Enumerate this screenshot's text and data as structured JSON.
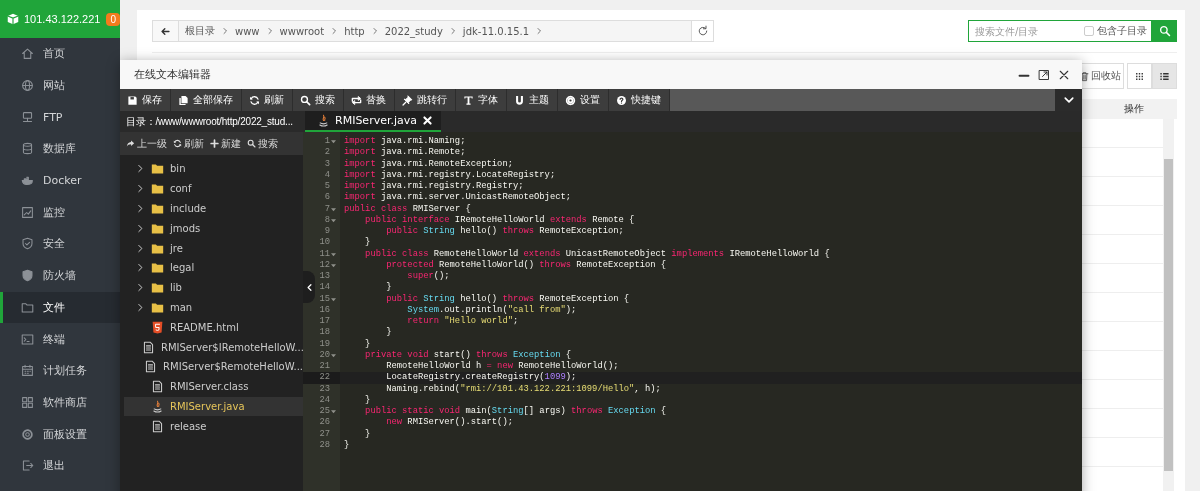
{
  "sidebar": {
    "host": "101.43.122.221",
    "badge": "0",
    "items": [
      {
        "label": "首页",
        "selected": false
      },
      {
        "label": "网站",
        "selected": false
      },
      {
        "label": "FTP",
        "selected": false
      },
      {
        "label": "数据库",
        "selected": false
      },
      {
        "label": "Docker",
        "selected": false
      },
      {
        "label": "监控",
        "selected": false
      },
      {
        "label": "安全",
        "selected": false
      },
      {
        "label": "防火墙",
        "selected": false
      },
      {
        "label": "文件",
        "selected": true
      },
      {
        "label": "终端",
        "selected": false
      },
      {
        "label": "计划任务",
        "selected": false
      },
      {
        "label": "软件商店",
        "selected": false
      },
      {
        "label": "面板设置",
        "selected": false
      },
      {
        "label": "退出",
        "selected": false
      }
    ]
  },
  "file_manager": {
    "breadcrumb": [
      "根目录",
      "www",
      "wwwroot",
      "http",
      "2022_study",
      "jdk-11.0.15.1"
    ],
    "search": {
      "placeholder": "搜索文件/目录",
      "subdir_label": "包含子目录",
      "subdir_checked": false
    },
    "recycle_label": "回收站",
    "view_modes": [
      {
        "selected": false
      },
      {
        "selected": true
      }
    ],
    "table": {
      "columns": [
        "操作"
      ]
    }
  },
  "editor": {
    "title": "在线文本编辑器",
    "toolbar": [
      "保存",
      "全部保存",
      "刷新",
      "搜索",
      "替换",
      "跳转行",
      "字体",
      "主题",
      "设置",
      "快捷键"
    ],
    "path": "目录：/www/wwwroot/http/2022_stud...",
    "file_actions": [
      "上一级",
      "刷新",
      "新建",
      "搜索"
    ],
    "files": [
      {
        "name": "bin",
        "kind": "folder",
        "selected": false
      },
      {
        "name": "conf",
        "kind": "folder",
        "selected": false
      },
      {
        "name": "include",
        "kind": "folder",
        "selected": false
      },
      {
        "name": "jmods",
        "kind": "folder",
        "selected": false
      },
      {
        "name": "jre",
        "kind": "folder",
        "selected": false
      },
      {
        "name": "legal",
        "kind": "folder",
        "selected": false
      },
      {
        "name": "lib",
        "kind": "folder",
        "selected": false
      },
      {
        "name": "man",
        "kind": "folder",
        "selected": false
      },
      {
        "name": "README.html",
        "kind": "html",
        "selected": false
      },
      {
        "name": "RMIServer$IRemoteHelloW...",
        "kind": "file",
        "selected": false
      },
      {
        "name": "RMIServer$RemoteHelloW...",
        "kind": "file",
        "selected": false
      },
      {
        "name": "RMIServer.class",
        "kind": "file",
        "selected": false
      },
      {
        "name": "RMIServer.java",
        "kind": "java",
        "selected": true
      },
      {
        "name": "release",
        "kind": "file",
        "selected": false
      }
    ],
    "tabs": [
      {
        "label": "RMIServer.java",
        "selected": true
      }
    ],
    "lines": [
      {
        "number": "1",
        "foldable": true,
        "active": false,
        "tokens": [
          {
            "kind": "keyword",
            "text": "import"
          },
          {
            "kind": "plain",
            "text": " java.rmi.Naming;"
          }
        ]
      },
      {
        "number": "2",
        "foldable": false,
        "active": false,
        "tokens": [
          {
            "kind": "keyword",
            "text": "import"
          },
          {
            "kind": "plain",
            "text": " java.rmi.Remote;"
          }
        ]
      },
      {
        "number": "3",
        "foldable": false,
        "active": false,
        "tokens": [
          {
            "kind": "keyword",
            "text": "import"
          },
          {
            "kind": "plain",
            "text": " java.rmi.RemoteException;"
          }
        ]
      },
      {
        "number": "4",
        "foldable": false,
        "active": false,
        "tokens": [
          {
            "kind": "keyword",
            "text": "import"
          },
          {
            "kind": "plain",
            "text": " java.rmi.registry.LocateRegistry;"
          }
        ]
      },
      {
        "number": "5",
        "foldable": false,
        "active": false,
        "tokens": [
          {
            "kind": "keyword",
            "text": "import"
          },
          {
            "kind": "plain",
            "text": " java.rmi.registry.Registry;"
          }
        ]
      },
      {
        "number": "6",
        "foldable": false,
        "active": false,
        "tokens": [
          {
            "kind": "keyword",
            "text": "import"
          },
          {
            "kind": "plain",
            "text": " java.rmi.server.UnicastRemoteObject;"
          }
        ]
      },
      {
        "number": "7",
        "foldable": true,
        "active": false,
        "tokens": [
          {
            "kind": "keyword",
            "text": "public"
          },
          {
            "kind": "keyword",
            "text": " class"
          },
          {
            "kind": "plain",
            "text": " RMIServer {"
          }
        ]
      },
      {
        "number": "8",
        "foldable": true,
        "active": false,
        "tokens": [
          {
            "kind": "keyword",
            "text": "    public"
          },
          {
            "kind": "keyword",
            "text": " interface"
          },
          {
            "kind": "plain",
            "text": " IRemoteHelloWorld "
          },
          {
            "kind": "keyword",
            "text": "extends"
          },
          {
            "kind": "plain",
            "text": " Remote {"
          }
        ]
      },
      {
        "number": "9",
        "foldable": false,
        "active": false,
        "tokens": [
          {
            "kind": "keyword",
            "text": "        public"
          },
          {
            "kind": "type",
            "text": " String"
          },
          {
            "kind": "plain",
            "text": " hello() "
          },
          {
            "kind": "keyword",
            "text": "throws"
          },
          {
            "kind": "plain",
            "text": " RemoteException;"
          }
        ]
      },
      {
        "number": "10",
        "foldable": false,
        "active": false,
        "tokens": [
          {
            "kind": "plain",
            "text": "    }"
          }
        ]
      },
      {
        "number": "11",
        "foldable": true,
        "active": false,
        "tokens": [
          {
            "kind": "keyword",
            "text": "    public"
          },
          {
            "kind": "keyword",
            "text": " class"
          },
          {
            "kind": "plain",
            "text": " RemoteHelloWorld "
          },
          {
            "kind": "keyword",
            "text": "extends"
          },
          {
            "kind": "plain",
            "text": " UnicastRemoteObject "
          },
          {
            "kind": "keyword",
            "text": "implements"
          },
          {
            "kind": "plain",
            "text": " IRemoteHelloWorld {"
          }
        ]
      },
      {
        "number": "12",
        "foldable": true,
        "active": false,
        "tokens": [
          {
            "kind": "keyword",
            "text": "        protected"
          },
          {
            "kind": "plain",
            "text": " RemoteHelloWorld() "
          },
          {
            "kind": "keyword",
            "text": "throws"
          },
          {
            "kind": "plain",
            "text": " RemoteException {"
          }
        ]
      },
      {
        "number": "13",
        "foldable": false,
        "active": false,
        "tokens": [
          {
            "kind": "keyword",
            "text": "            super"
          },
          {
            "kind": "plain",
            "text": "();"
          }
        ]
      },
      {
        "number": "14",
        "foldable": false,
        "active": false,
        "tokens": [
          {
            "kind": "plain",
            "text": "        }"
          }
        ]
      },
      {
        "number": "15",
        "foldable": true,
        "active": false,
        "tokens": [
          {
            "kind": "keyword",
            "text": "        public"
          },
          {
            "kind": "type",
            "text": " String"
          },
          {
            "kind": "plain",
            "text": " hello() "
          },
          {
            "kind": "keyword",
            "text": "throws"
          },
          {
            "kind": "plain",
            "text": " RemoteException {"
          }
        ]
      },
      {
        "number": "16",
        "foldable": false,
        "active": false,
        "tokens": [
          {
            "kind": "type",
            "text": "            System"
          },
          {
            "kind": "plain",
            "text": ".out.println("
          },
          {
            "kind": "string",
            "text": "\"call from\""
          },
          {
            "kind": "plain",
            "text": ");"
          }
        ]
      },
      {
        "number": "17",
        "foldable": false,
        "active": false,
        "tokens": [
          {
            "kind": "keyword",
            "text": "            return"
          },
          {
            "kind": "string",
            "text": " \"Hello world\""
          },
          {
            "kind": "plain",
            "text": ";"
          }
        ]
      },
      {
        "number": "18",
        "foldable": false,
        "active": false,
        "tokens": [
          {
            "kind": "plain",
            "text": "        }"
          }
        ]
      },
      {
        "number": "19",
        "foldable": false,
        "active": false,
        "tokens": [
          {
            "kind": "plain",
            "text": "    }"
          }
        ]
      },
      {
        "number": "20",
        "foldable": true,
        "active": false,
        "tokens": [
          {
            "kind": "keyword",
            "text": "    private"
          },
          {
            "kind": "keyword",
            "text": " void"
          },
          {
            "kind": "plain",
            "text": " start() "
          },
          {
            "kind": "keyword",
            "text": "throws"
          },
          {
            "kind": "type",
            "text": " Exception"
          },
          {
            "kind": "plain",
            "text": " {"
          }
        ]
      },
      {
        "number": "21",
        "foldable": false,
        "active": false,
        "tokens": [
          {
            "kind": "plain",
            "text": "        RemoteHelloWorld h "
          },
          {
            "kind": "keyword",
            "text": "="
          },
          {
            "kind": "keyword",
            "text": " new"
          },
          {
            "kind": "plain",
            "text": " RemoteHelloWorld();"
          }
        ]
      },
      {
        "number": "22",
        "foldable": false,
        "active": true,
        "tokens": [
          {
            "kind": "plain",
            "text": "        LocateRegistry.createRegistry("
          },
          {
            "kind": "number",
            "text": "1099"
          },
          {
            "kind": "plain",
            "text": ");"
          }
        ]
      },
      {
        "number": "23",
        "foldable": false,
        "active": false,
        "tokens": [
          {
            "kind": "plain",
            "text": "        Naming.rebind("
          },
          {
            "kind": "string",
            "text": "\"rmi://101.43.122.221:1099/Hello\""
          },
          {
            "kind": "plain",
            "text": ", h);"
          }
        ]
      },
      {
        "number": "24",
        "foldable": false,
        "active": false,
        "tokens": [
          {
            "kind": "plain",
            "text": "    }"
          }
        ]
      },
      {
        "number": "25",
        "foldable": true,
        "active": false,
        "tokens": [
          {
            "kind": "keyword",
            "text": "    public"
          },
          {
            "kind": "keyword",
            "text": " static"
          },
          {
            "kind": "keyword",
            "text": " void"
          },
          {
            "kind": "plain",
            "text": " main("
          },
          {
            "kind": "type",
            "text": "String"
          },
          {
            "kind": "plain",
            "text": "[] args) "
          },
          {
            "kind": "keyword",
            "text": "throws"
          },
          {
            "kind": "type",
            "text": " Exception"
          },
          {
            "kind": "plain",
            "text": " {"
          }
        ]
      },
      {
        "number": "26",
        "foldable": false,
        "active": false,
        "tokens": [
          {
            "kind": "keyword",
            "text": "        new"
          },
          {
            "kind": "plain",
            "text": " RMIServer().start();"
          }
        ]
      },
      {
        "number": "27",
        "foldable": false,
        "active": false,
        "tokens": [
          {
            "kind": "plain",
            "text": "    }"
          }
        ]
      },
      {
        "number": "28",
        "foldable": false,
        "active": false,
        "tokens": [
          {
            "kind": "plain",
            "text": "}"
          }
        ]
      }
    ]
  }
}
